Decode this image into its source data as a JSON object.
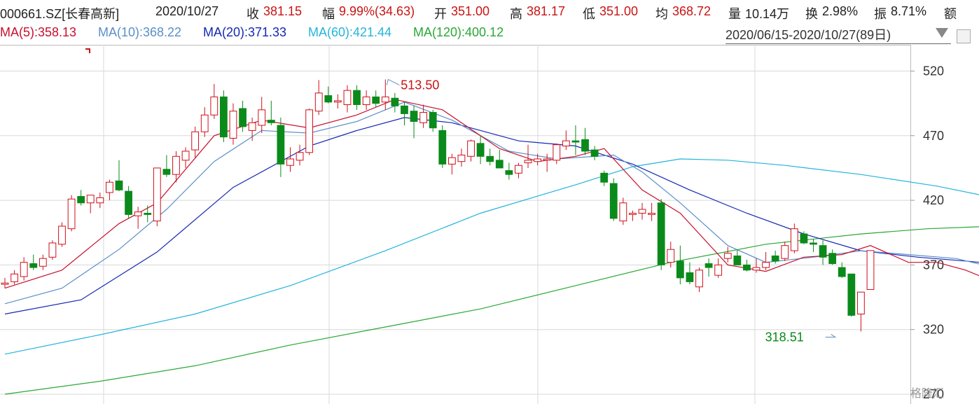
{
  "header": {
    "code": "000661.SZ[长春高新]",
    "date": "2020/10/27",
    "close_label": "收",
    "close": "381.15",
    "amp_label": "幅",
    "amp": "9.99%(34.63)",
    "open_label": "开",
    "open": "351.00",
    "high_label": "高",
    "high": "381.17",
    "low_label": "低",
    "low": "351.00",
    "avg_label": "均",
    "avg": "368.72",
    "vol_label": "量",
    "vol": "10.14万",
    "turn_label": "换",
    "turn": "2.98%",
    "swing_label": "振",
    "swing": "8.71%",
    "extra_label": "额"
  },
  "ma_legend": {
    "ma5": "MA(5):358.13",
    "ma10": "MA(10):368.22",
    "ma20": "MA(20):371.33",
    "ma60": "MA(60):421.44",
    "ma120": "MA(120):400.12"
  },
  "range": "2020/06/15-2020/10/27(89日)",
  "watermark": "格隆汇",
  "colors": {
    "up": "#d0101a",
    "down": "#0a8a1a",
    "ma5": "#c8102e",
    "ma10": "#5b8fc8",
    "ma20": "#1428b4",
    "ma60": "#24b4dc",
    "ma120": "#2aa834",
    "grid": "#d8d8d8"
  },
  "chart_data": {
    "type": "candlestick",
    "ylim": [
      270,
      530
    ],
    "yticks": [
      "520",
      "470",
      "420",
      "370",
      "320",
      "270"
    ],
    "annotations": [
      {
        "text": "513.50",
        "value": 513.5,
        "index": 40
      },
      {
        "text": "318.51",
        "value": 318.51,
        "index": 87
      }
    ],
    "candles": [
      {
        "o": 355,
        "h": 360,
        "l": 352,
        "c": 356
      },
      {
        "o": 357,
        "h": 366,
        "l": 355,
        "c": 363
      },
      {
        "o": 361,
        "h": 376,
        "l": 358,
        "c": 372
      },
      {
        "o": 371,
        "h": 378,
        "l": 366,
        "c": 368
      },
      {
        "o": 369,
        "h": 378,
        "l": 366,
        "c": 375
      },
      {
        "o": 376,
        "h": 389,
        "l": 374,
        "c": 387
      },
      {
        "o": 386,
        "h": 403,
        "l": 384,
        "c": 400
      },
      {
        "o": 398,
        "h": 424,
        "l": 396,
        "c": 421
      },
      {
        "o": 423,
        "h": 428,
        "l": 416,
        "c": 418
      },
      {
        "o": 418,
        "h": 424,
        "l": 410,
        "c": 424
      },
      {
        "o": 418,
        "h": 426,
        "l": 414,
        "c": 422
      },
      {
        "o": 426,
        "h": 436,
        "l": 420,
        "c": 434
      },
      {
        "o": 435,
        "h": 451,
        "l": 427,
        "c": 428
      },
      {
        "o": 427,
        "h": 431,
        "l": 406,
        "c": 409
      },
      {
        "o": 408,
        "h": 415,
        "l": 398,
        "c": 411
      },
      {
        "o": 410,
        "h": 416,
        "l": 403,
        "c": 409
      },
      {
        "o": 404,
        "h": 445,
        "l": 400,
        "c": 445
      },
      {
        "o": 444,
        "h": 455,
        "l": 438,
        "c": 440
      },
      {
        "o": 440,
        "h": 458,
        "l": 434,
        "c": 454
      },
      {
        "o": 451,
        "h": 461,
        "l": 445,
        "c": 458
      },
      {
        "o": 459,
        "h": 477,
        "l": 453,
        "c": 473
      },
      {
        "o": 473,
        "h": 492,
        "l": 469,
        "c": 486
      },
      {
        "o": 486,
        "h": 510,
        "l": 483,
        "c": 500
      },
      {
        "o": 500,
        "h": 505,
        "l": 465,
        "c": 469
      },
      {
        "o": 468,
        "h": 495,
        "l": 463,
        "c": 489
      },
      {
        "o": 491,
        "h": 497,
        "l": 473,
        "c": 477
      },
      {
        "o": 474,
        "h": 484,
        "l": 466,
        "c": 480
      },
      {
        "o": 478,
        "h": 500,
        "l": 472,
        "c": 490
      },
      {
        "o": 482,
        "h": 497,
        "l": 478,
        "c": 480
      },
      {
        "o": 478,
        "h": 484,
        "l": 438,
        "c": 448
      },
      {
        "o": 447,
        "h": 461,
        "l": 442,
        "c": 452
      },
      {
        "o": 451,
        "h": 463,
        "l": 447,
        "c": 457
      },
      {
        "o": 457,
        "h": 491,
        "l": 455,
        "c": 490
      },
      {
        "o": 489,
        "h": 513,
        "l": 486,
        "c": 503
      },
      {
        "o": 501,
        "h": 508,
        "l": 495,
        "c": 496
      },
      {
        "o": 496,
        "h": 502,
        "l": 491,
        "c": 497
      },
      {
        "o": 494,
        "h": 509,
        "l": 488,
        "c": 505
      },
      {
        "o": 505,
        "h": 509,
        "l": 490,
        "c": 494
      },
      {
        "o": 494,
        "h": 505,
        "l": 490,
        "c": 500
      },
      {
        "o": 500,
        "h": 505,
        "l": 492,
        "c": 495
      },
      {
        "o": 496,
        "h": 513.5,
        "l": 490,
        "c": 500
      },
      {
        "o": 499,
        "h": 503,
        "l": 488,
        "c": 493
      },
      {
        "o": 493,
        "h": 496,
        "l": 478,
        "c": 487
      },
      {
        "o": 489,
        "h": 493,
        "l": 468,
        "c": 481
      },
      {
        "o": 480,
        "h": 494,
        "l": 476,
        "c": 488
      },
      {
        "o": 488,
        "h": 490,
        "l": 473,
        "c": 476
      },
      {
        "o": 474,
        "h": 478,
        "l": 445,
        "c": 448
      },
      {
        "o": 448,
        "h": 456,
        "l": 440,
        "c": 453
      },
      {
        "o": 450,
        "h": 460,
        "l": 446,
        "c": 455
      },
      {
        "o": 454,
        "h": 467,
        "l": 450,
        "c": 466
      },
      {
        "o": 464,
        "h": 470,
        "l": 448,
        "c": 454
      },
      {
        "o": 454,
        "h": 460,
        "l": 447,
        "c": 450
      },
      {
        "o": 451,
        "h": 459,
        "l": 445,
        "c": 445
      },
      {
        "o": 443,
        "h": 449,
        "l": 436,
        "c": 440
      },
      {
        "o": 441,
        "h": 449,
        "l": 437,
        "c": 447
      },
      {
        "o": 449,
        "h": 463,
        "l": 445,
        "c": 451
      },
      {
        "o": 450,
        "h": 456,
        "l": 447,
        "c": 452
      },
      {
        "o": 451,
        "h": 456,
        "l": 442,
        "c": 452
      },
      {
        "o": 451,
        "h": 464,
        "l": 448,
        "c": 463
      },
      {
        "o": 462,
        "h": 474,
        "l": 459,
        "c": 466
      },
      {
        "o": 466,
        "h": 478,
        "l": 455,
        "c": 465
      },
      {
        "o": 467,
        "h": 476,
        "l": 455,
        "c": 458
      },
      {
        "o": 459,
        "h": 462,
        "l": 451,
        "c": 454
      },
      {
        "o": 441,
        "h": 443,
        "l": 431,
        "c": 434
      },
      {
        "o": 433,
        "h": 437,
        "l": 404,
        "c": 406
      },
      {
        "o": 404,
        "h": 422,
        "l": 401,
        "c": 418
      },
      {
        "o": 409,
        "h": 412,
        "l": 404,
        "c": 410
      },
      {
        "o": 410,
        "h": 418,
        "l": 405,
        "c": 413
      },
      {
        "o": 409,
        "h": 418,
        "l": 404,
        "c": 410
      },
      {
        "o": 418,
        "h": 421,
        "l": 366,
        "c": 370
      },
      {
        "o": 372,
        "h": 388,
        "l": 368,
        "c": 382
      },
      {
        "o": 373,
        "h": 385,
        "l": 355,
        "c": 360
      },
      {
        "o": 364,
        "h": 372,
        "l": 355,
        "c": 357
      },
      {
        "o": 353,
        "h": 368,
        "l": 349,
        "c": 366
      },
      {
        "o": 371,
        "h": 375,
        "l": 361,
        "c": 368
      },
      {
        "o": 362,
        "h": 375,
        "l": 360,
        "c": 370
      },
      {
        "o": 375,
        "h": 384,
        "l": 372,
        "c": 379
      },
      {
        "o": 377,
        "h": 382,
        "l": 370,
        "c": 370
      },
      {
        "o": 370,
        "h": 374,
        "l": 365,
        "c": 366
      },
      {
        "o": 366,
        "h": 375,
        "l": 364,
        "c": 368
      },
      {
        "o": 368,
        "h": 380,
        "l": 366,
        "c": 372
      },
      {
        "o": 377,
        "h": 381,
        "l": 371,
        "c": 373
      },
      {
        "o": 375,
        "h": 388,
        "l": 373,
        "c": 385
      },
      {
        "o": 381,
        "h": 402,
        "l": 379,
        "c": 398
      },
      {
        "o": 394,
        "h": 396,
        "l": 386,
        "c": 387
      },
      {
        "o": 387,
        "h": 390,
        "l": 380,
        "c": 386
      },
      {
        "o": 385,
        "h": 389,
        "l": 370,
        "c": 376
      },
      {
        "o": 379,
        "h": 382,
        "l": 370,
        "c": 371
      },
      {
        "o": 368,
        "h": 372,
        "l": 360,
        "c": 361
      },
      {
        "o": 363,
        "h": 350,
        "l": 330,
        "c": 331
      },
      {
        "o": 332,
        "h": 349,
        "l": 318.51,
        "c": 349
      },
      {
        "o": 351,
        "h": 381.17,
        "l": 351,
        "c": 381.15
      }
    ],
    "ma5": [
      [
        0,
        352
      ],
      [
        6,
        366
      ],
      [
        12,
        402
      ],
      [
        16,
        418
      ],
      [
        22,
        470
      ],
      [
        27,
        482
      ],
      [
        32,
        476
      ],
      [
        37,
        486
      ],
      [
        41,
        498
      ],
      [
        46,
        490
      ],
      [
        52,
        460
      ],
      [
        56,
        450
      ],
      [
        60,
        454
      ],
      [
        63,
        460
      ],
      [
        67,
        428
      ],
      [
        71,
        410
      ],
      [
        76,
        370
      ],
      [
        80,
        365
      ],
      [
        84,
        376
      ],
      [
        88,
        378
      ],
      [
        91,
        385
      ],
      [
        95,
        372
      ],
      [
        98,
        372
      ],
      [
        101,
        366
      ],
      [
        104,
        357
      ]
    ],
    "ma10": [
      [
        0,
        340
      ],
      [
        6,
        352
      ],
      [
        12,
        382
      ],
      [
        17,
        413
      ],
      [
        22,
        450
      ],
      [
        27,
        474
      ],
      [
        32,
        472
      ],
      [
        37,
        481
      ],
      [
        42,
        496
      ],
      [
        47,
        482
      ],
      [
        53,
        458
      ],
      [
        58,
        452
      ],
      [
        64,
        455
      ],
      [
        67,
        442
      ],
      [
        71,
        418
      ],
      [
        76,
        385
      ],
      [
        80,
        372
      ],
      [
        85,
        376
      ],
      [
        90,
        381
      ],
      [
        95,
        378
      ],
      [
        100,
        375
      ],
      [
        104,
        368
      ]
    ],
    "ma20": [
      [
        0,
        332
      ],
      [
        8,
        343
      ],
      [
        16,
        380
      ],
      [
        24,
        430
      ],
      [
        32,
        462
      ],
      [
        37,
        474
      ],
      [
        42,
        484
      ],
      [
        47,
        480
      ],
      [
        54,
        466
      ],
      [
        60,
        462
      ],
      [
        66,
        448
      ],
      [
        72,
        428
      ],
      [
        78,
        410
      ],
      [
        84,
        394
      ],
      [
        90,
        381
      ],
      [
        96,
        376
      ],
      [
        101,
        373
      ],
      [
        104,
        371
      ]
    ],
    "ma60": [
      [
        0,
        301
      ],
      [
        10,
        316
      ],
      [
        20,
        332
      ],
      [
        30,
        354
      ],
      [
        40,
        381
      ],
      [
        50,
        410
      ],
      [
        60,
        432
      ],
      [
        66,
        446
      ],
      [
        71,
        452
      ],
      [
        76,
        451
      ],
      [
        82,
        447
      ],
      [
        90,
        440
      ],
      [
        98,
        431
      ],
      [
        104,
        422
      ]
    ],
    "ma120": [
      [
        0,
        270
      ],
      [
        10,
        280
      ],
      [
        20,
        292
      ],
      [
        30,
        308
      ],
      [
        40,
        322
      ],
      [
        50,
        336
      ],
      [
        60,
        354
      ],
      [
        70,
        372
      ],
      [
        80,
        386
      ],
      [
        90,
        394
      ],
      [
        97,
        398
      ],
      [
        104,
        400
      ]
    ]
  }
}
